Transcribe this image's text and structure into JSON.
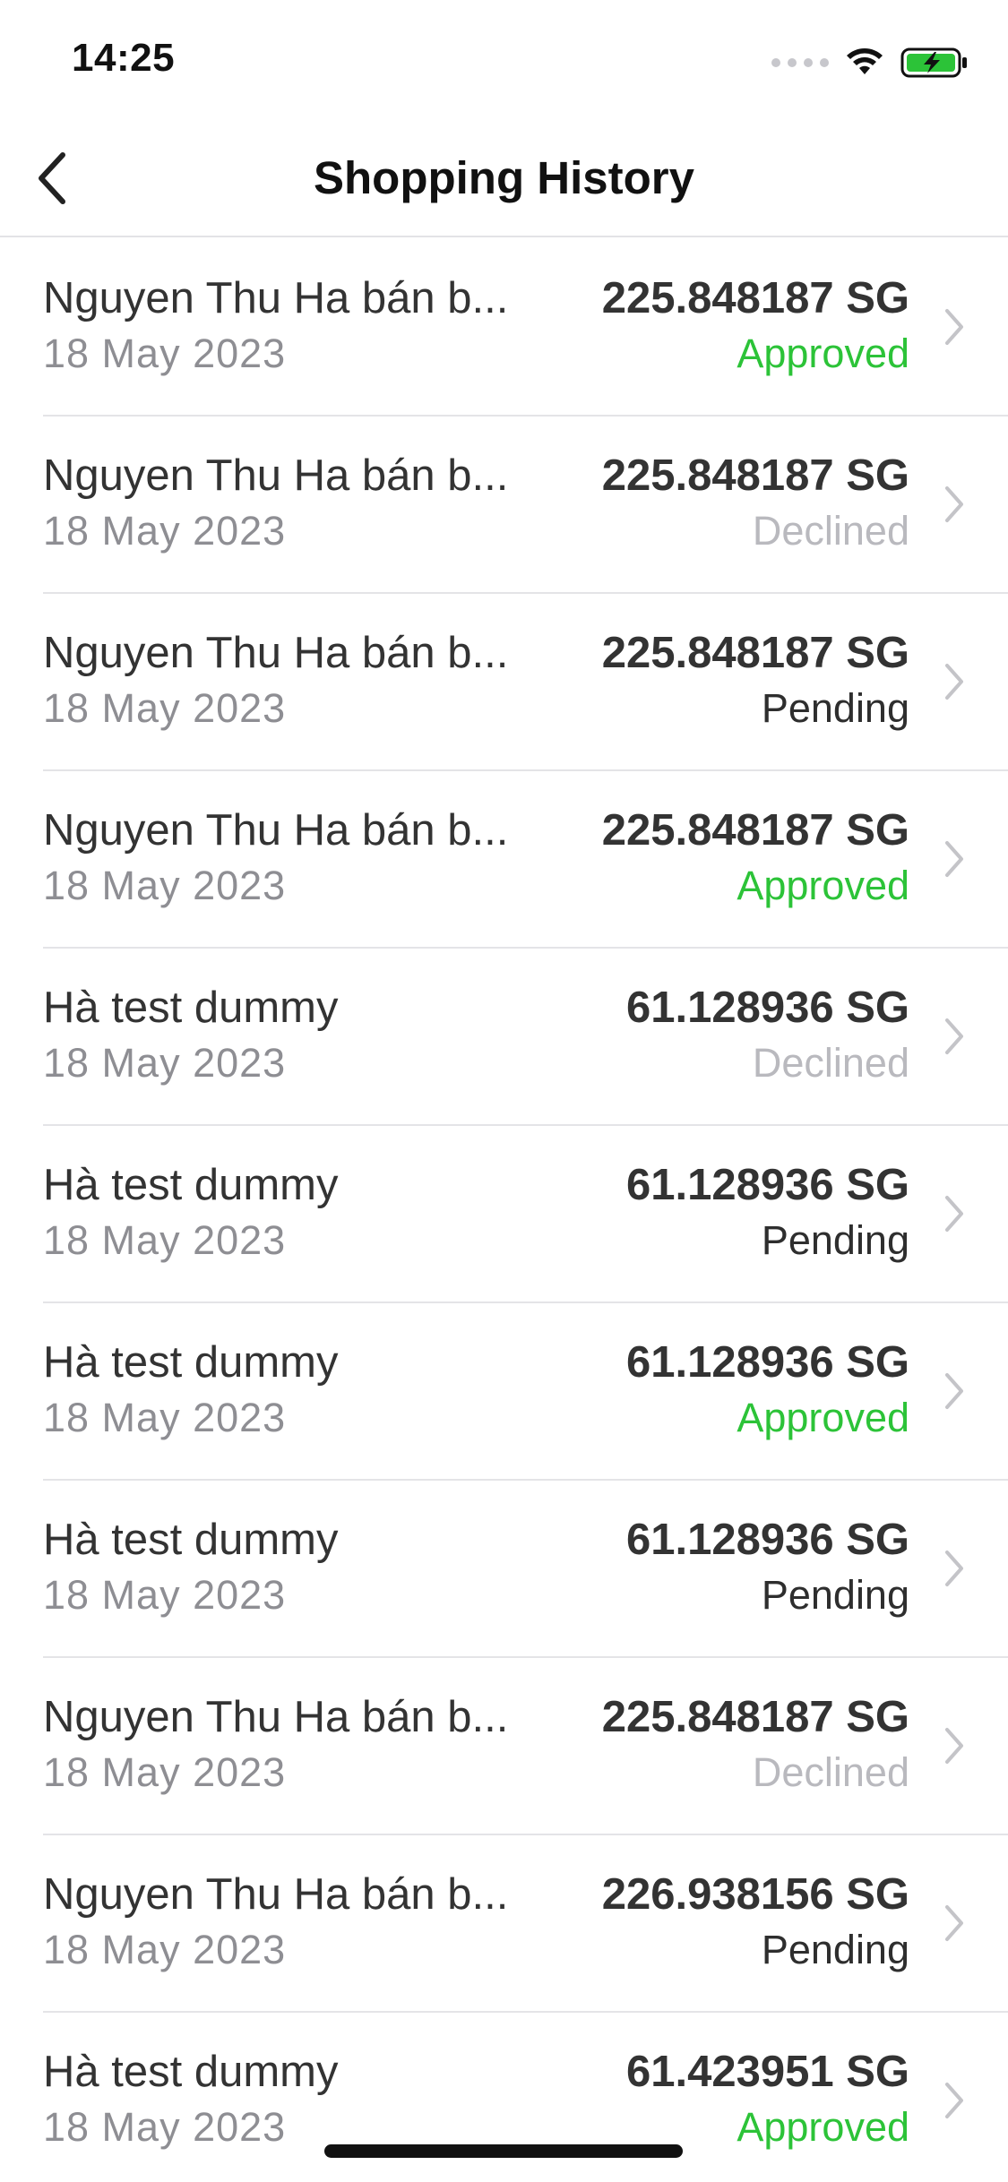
{
  "status_bar": {
    "time": "14:25"
  },
  "nav": {
    "title": "Shopping History"
  },
  "colors": {
    "approved": "#2cc338",
    "declined": "#b9b9be",
    "pending": "#2e2e2e",
    "battery": "#2cc338"
  },
  "rows": [
    {
      "name": "Nguyen Thu Ha bán b...",
      "date": "18 May 2023",
      "amount": "225.848187 SG",
      "status": "Approved",
      "status_type": "approved"
    },
    {
      "name": "Nguyen Thu Ha bán b...",
      "date": "18 May 2023",
      "amount": "225.848187 SG",
      "status": "Declined",
      "status_type": "declined"
    },
    {
      "name": "Nguyen Thu Ha bán b...",
      "date": "18 May 2023",
      "amount": "225.848187 SG",
      "status": "Pending",
      "status_type": "pending"
    },
    {
      "name": "Nguyen Thu Ha bán b...",
      "date": "18 May 2023",
      "amount": "225.848187 SG",
      "status": "Approved",
      "status_type": "approved"
    },
    {
      "name": "Hà test dummy",
      "date": "18 May 2023",
      "amount": "61.128936 SG",
      "status": "Declined",
      "status_type": "declined"
    },
    {
      "name": "Hà test dummy",
      "date": "18 May 2023",
      "amount": "61.128936 SG",
      "status": "Pending",
      "status_type": "pending"
    },
    {
      "name": "Hà test dummy",
      "date": "18 May 2023",
      "amount": "61.128936 SG",
      "status": "Approved",
      "status_type": "approved"
    },
    {
      "name": "Hà test dummy",
      "date": "18 May 2023",
      "amount": "61.128936 SG",
      "status": "Pending",
      "status_type": "pending"
    },
    {
      "name": "Nguyen Thu Ha bán b...",
      "date": "18 May 2023",
      "amount": "225.848187 SG",
      "status": "Declined",
      "status_type": "declined"
    },
    {
      "name": "Nguyen Thu Ha bán b...",
      "date": "18 May 2023",
      "amount": "226.938156 SG",
      "status": "Pending",
      "status_type": "pending"
    },
    {
      "name": "Hà test dummy",
      "date": "18 May 2023",
      "amount": "61.423951 SG",
      "status": "Approved",
      "status_type": "approved"
    }
  ]
}
